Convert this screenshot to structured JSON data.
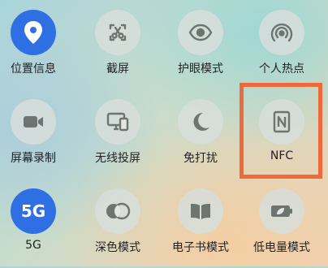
{
  "tiles": [
    {
      "label": "位置信息",
      "icon": "location-pin-icon",
      "active": true
    },
    {
      "label": "截屏",
      "icon": "screenshot-scissors-icon",
      "active": false
    },
    {
      "label": "护眼模式",
      "icon": "eye-icon",
      "active": false
    },
    {
      "label": "个人热点",
      "icon": "hotspot-icon",
      "active": false
    },
    {
      "label": "屏幕录制",
      "icon": "video-camera-icon",
      "active": false
    },
    {
      "label": "无线投屏",
      "icon": "cast-screen-icon",
      "active": false
    },
    {
      "label": "免打扰",
      "icon": "moon-icon",
      "active": false
    },
    {
      "label": "NFC",
      "icon": "nfc-icon",
      "active": false,
      "highlighted": true
    },
    {
      "label": "5G",
      "icon": "5g-icon",
      "active": true,
      "icon_text": "5G"
    },
    {
      "label": "深色模式",
      "icon": "dark-mode-icon",
      "active": false
    },
    {
      "label": "电子书模式",
      "icon": "ebook-icon",
      "active": false
    },
    {
      "label": "低电量模式",
      "icon": "low-battery-icon",
      "active": false
    }
  ],
  "colors": {
    "active": "#2f6fe4",
    "icon": "#6e7470",
    "highlight": "#ef6a3a"
  }
}
